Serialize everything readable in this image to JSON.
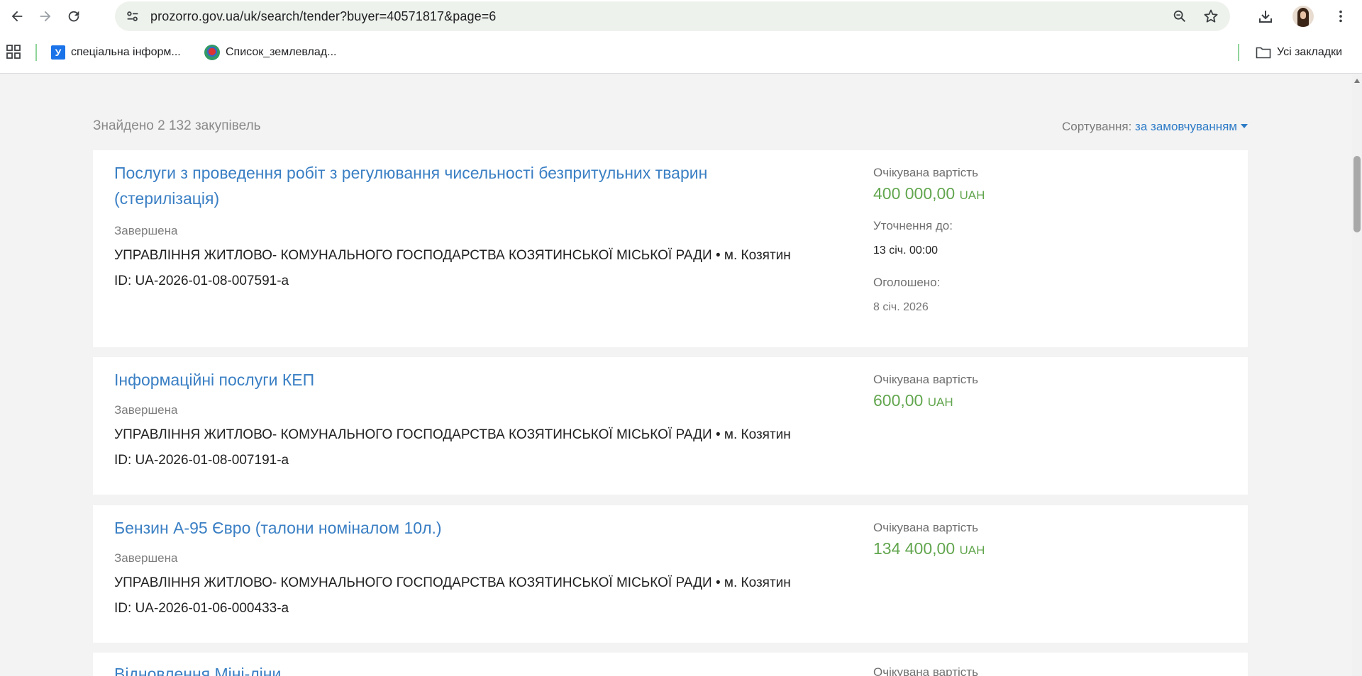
{
  "browser": {
    "url": "prozorro.gov.ua/uk/search/tender?buyer=40571817&page=6",
    "bookmarks": [
      {
        "label": "спеціальна інформ..."
      },
      {
        "label": "Список_землевлад..."
      }
    ],
    "all_bookmarks_label": "Усі закладки"
  },
  "results": {
    "found_text": "Знайдено 2 132 закупівель",
    "sort_label": "Сортування:",
    "sort_value": "за замовчуванням"
  },
  "labels": {
    "expected_cost": "Очікувана вартість",
    "clarify_until": "Уточнення до:",
    "announced": "Оголошено:"
  },
  "tenders": [
    {
      "title": "Послуги з проведення робіт з регулювання чисельності безпритульних тварин (стерилізація)",
      "status": "Завершена",
      "buyer": "УПРАВЛІННЯ ЖИТЛОВО- КОМУНАЛЬНОГО ГОСПОДАРСТВА КОЗЯТИНСЬКОЇ МІСЬКОЇ РАДИ • м. Козятин",
      "id": "ID: UA-2026-01-08-007591-a",
      "amount": "400 000,00",
      "currency": "UAH",
      "clarify_until": "13 січ. 00:00",
      "announced": "8 січ. 2026"
    },
    {
      "title": "Інформаційні послуги КЕП",
      "status": "Завершена",
      "buyer": "УПРАВЛІННЯ ЖИТЛОВО- КОМУНАЛЬНОГО ГОСПОДАРСТВА КОЗЯТИНСЬКОЇ МІСЬКОЇ РАДИ • м. Козятин",
      "id": "ID: UA-2026-01-08-007191-a",
      "amount": "600,00",
      "currency": "UAH"
    },
    {
      "title": "Бензин А-95 Євро (талони номіналом 10л.)",
      "status": "Завершена",
      "buyer": "УПРАВЛІННЯ ЖИТЛОВО- КОМУНАЛЬНОГО ГОСПОДАРСТВА КОЗЯТИНСЬКОЇ МІСЬКОЇ РАДИ • м. Козятин",
      "id": "ID: UA-2026-01-06-000433-a",
      "amount": "134 400,00",
      "currency": "UAH"
    },
    {
      "title": "Відновлення Міні-ліни...",
      "partial": true
    }
  ],
  "icons": [
    "back-icon",
    "forward-icon",
    "reload-icon",
    "site-settings-icon",
    "zoom-icon",
    "star-icon",
    "download-icon",
    "menu-icon",
    "apps-icon",
    "folder-icon"
  ]
}
